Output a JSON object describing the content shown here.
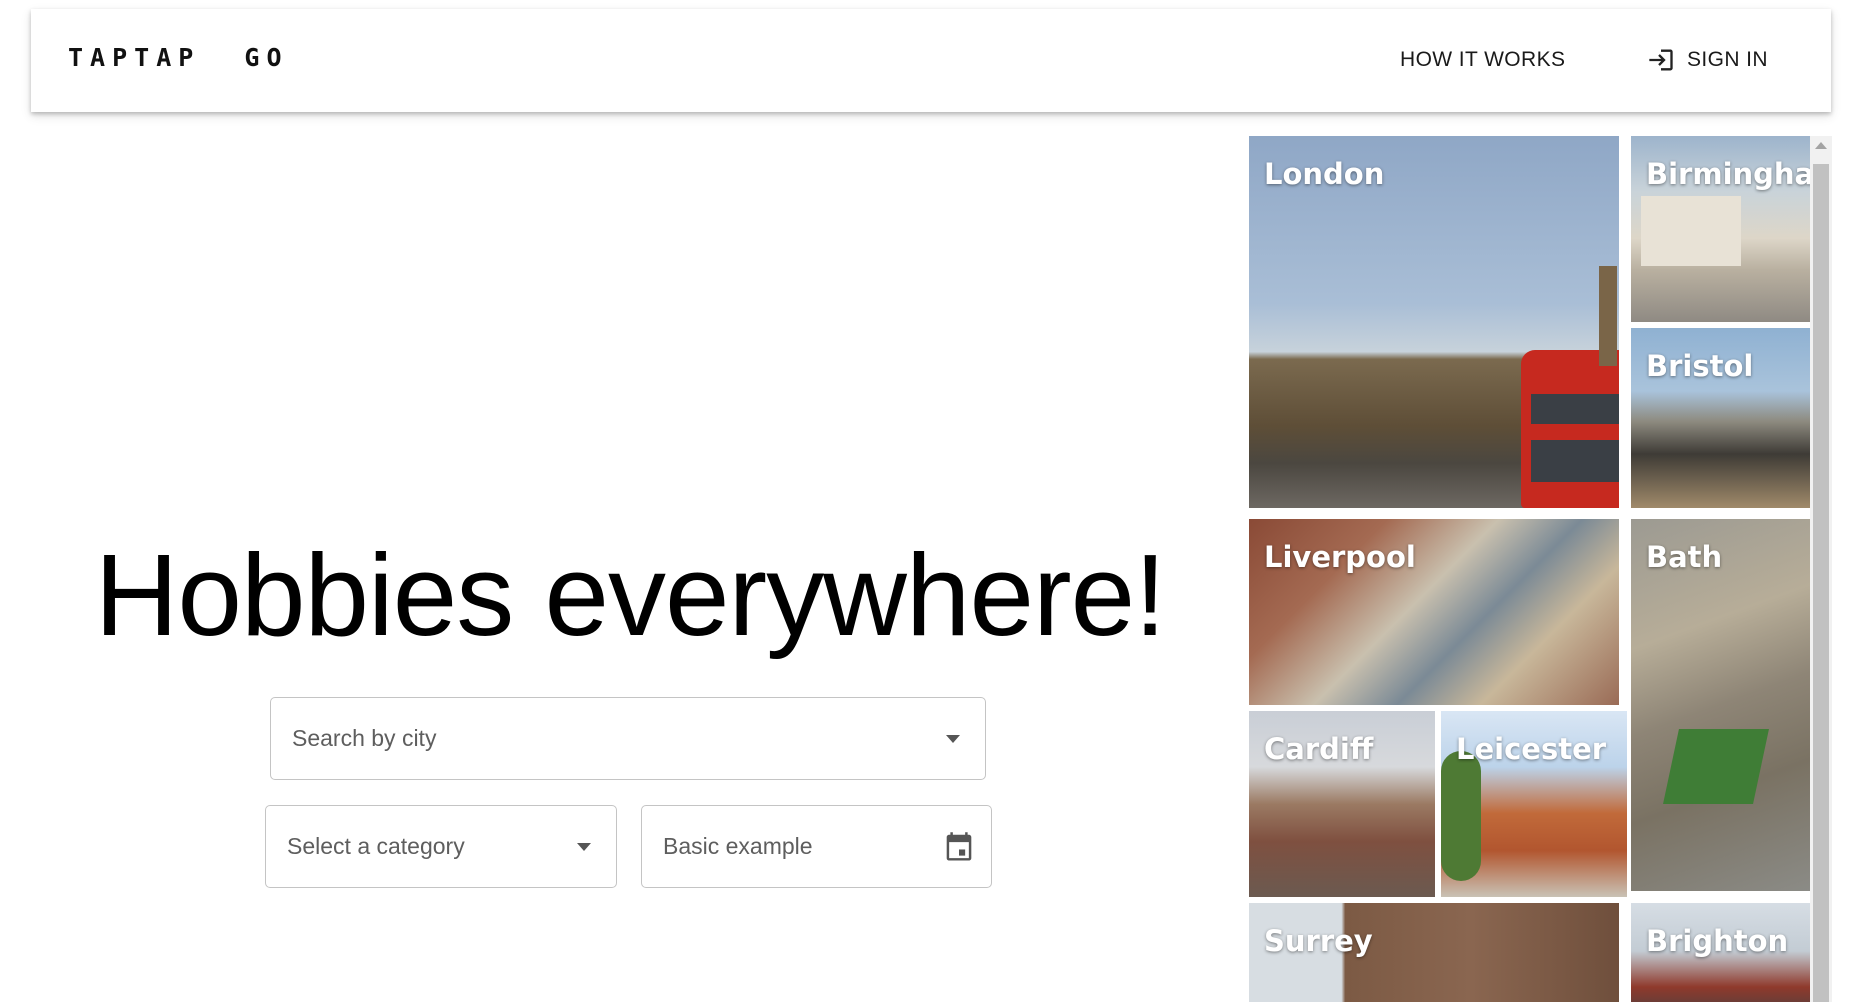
{
  "header": {
    "logo": "TAPTAP  GO",
    "how_it_works": "HOW IT WORKS",
    "sign_in": "SIGN IN"
  },
  "hero": {
    "title": "Hobbies everywhere!"
  },
  "search": {
    "city_placeholder": "Search by city",
    "category_placeholder": "Select a category",
    "date_placeholder": "Basic example"
  },
  "cities": [
    {
      "name": "London"
    },
    {
      "name": "Birmingham"
    },
    {
      "name": "Bristol"
    },
    {
      "name": "Liverpool"
    },
    {
      "name": "Bath"
    },
    {
      "name": "Cardiff"
    },
    {
      "name": "Leicester"
    },
    {
      "name": "Surrey"
    },
    {
      "name": "Brighton"
    }
  ]
}
